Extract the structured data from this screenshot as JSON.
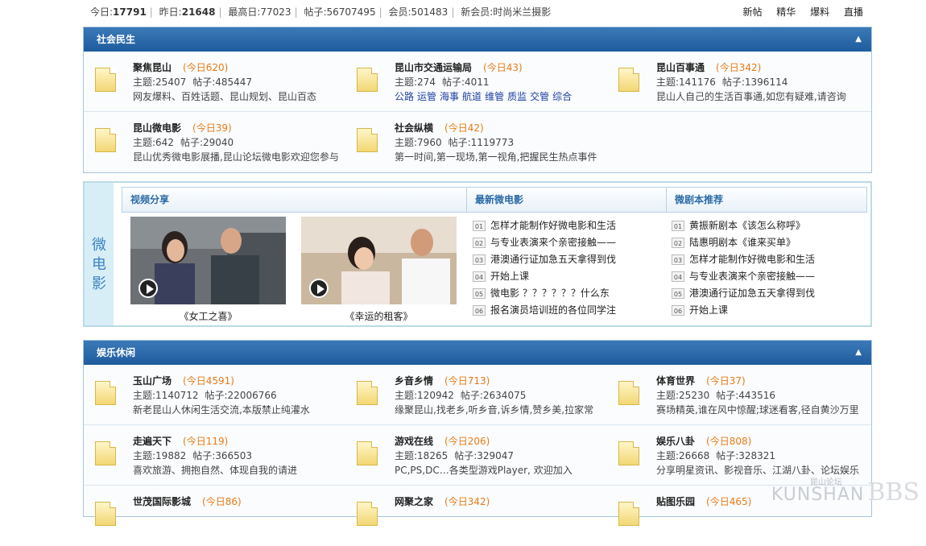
{
  "stats": {
    "today_label": "今日:",
    "today": "17791",
    "yesterday_label": "昨日:",
    "yesterday": "21648",
    "max_label": "最高日:",
    "max": "77023",
    "posts_label": "帖子:",
    "posts": "56707495",
    "members_label": "会员:",
    "members": "501483",
    "new_member_label": "新会员:",
    "new_member": "时尚米兰摄影"
  },
  "toplinks": [
    "新帖",
    "精华",
    "爆料",
    "直播"
  ],
  "section1": {
    "title": "社会民生",
    "forums": [
      {
        "name": "聚焦昆山",
        "today": "(今日620)",
        "topics": "主题:25407",
        "posts": "帖子:485447",
        "desc": "网友爆料、百姓话题、昆山规划、昆山百态"
      },
      {
        "name": "昆山市交通运输局",
        "today": "(今日43)",
        "topics": "主题:274",
        "posts": "帖子:4011",
        "links": [
          "公路",
          "运管",
          "海事",
          "航道",
          "维管",
          "质监",
          "交管",
          "综合"
        ]
      },
      {
        "name": "昆山百事通",
        "today": "(今日342)",
        "topics": "主题:141176",
        "posts": "帖子:1396114",
        "desc": "昆山人自己的生活百事通,如您有疑难,请咨询"
      },
      {
        "name": "昆山微电影",
        "today": "(今日39)",
        "topics": "主题:642",
        "posts": "帖子:29040",
        "desc": "昆山优秀微电影展播,昆山论坛微电影欢迎您参与"
      },
      {
        "name": "社会纵横",
        "today": "(今日42)",
        "topics": "主题:7960",
        "posts": "帖子:1119773",
        "desc": "第一时间,第一现场,第一视角,把握民生热点事件"
      }
    ]
  },
  "micro": {
    "side_label": [
      "微",
      "电",
      "影"
    ],
    "tabs": [
      "视频分享",
      "最新微电影",
      "微剧本推荐"
    ],
    "videos": [
      {
        "caption": "《女工之喜》"
      },
      {
        "caption": "《幸运的租客》"
      }
    ],
    "latest": [
      {
        "num": "01",
        "text": "怎样才能制作好微电影和生活"
      },
      {
        "num": "02",
        "text": "与专业表演来个亲密接触——"
      },
      {
        "num": "03",
        "text": "港澳通行证加急五天拿得到伐"
      },
      {
        "num": "04",
        "text": "开始上课"
      },
      {
        "num": "05",
        "text": "微电影 ？？？？？？什么东"
      },
      {
        "num": "06",
        "text": "报名演员培训班的各位同学注"
      }
    ],
    "scripts": [
      {
        "num": "01",
        "text": "黄振新剧本《该怎么称呼》"
      },
      {
        "num": "02",
        "text": "陆惠明剧本《谁来买单》"
      },
      {
        "num": "03",
        "text": "怎样才能制作好微电影和生活"
      },
      {
        "num": "04",
        "text": "与专业表演来个亲密接触——"
      },
      {
        "num": "05",
        "text": "港澳通行证加急五天拿得到伐"
      },
      {
        "num": "06",
        "text": "开始上课"
      }
    ]
  },
  "section2": {
    "title": "娱乐休闲",
    "forums": [
      {
        "name": "玉山广场",
        "today": "(今日4591)",
        "topics": "主题:1140712",
        "posts": "帖子:22006766",
        "desc": "新老昆山人休闲生活交流,本版禁止纯灌水"
      },
      {
        "name": "乡音乡情",
        "today": "(今日713)",
        "topics": "主题:120942",
        "posts": "帖子:2634075",
        "desc": "缘聚昆山,找老乡,听乡音,诉乡情,赞乡美,拉家常"
      },
      {
        "name": "体育世界",
        "today": "(今日37)",
        "topics": "主题:25230",
        "posts": "帖子:443516",
        "desc": "赛场精英,谁在风中惊醒;球迷看客,径自黄沙万里"
      },
      {
        "name": "走遍天下",
        "today": "(今日119)",
        "topics": "主题:19882",
        "posts": "帖子:366503",
        "desc": "喜欢旅游、拥抱自然、体现自我的请进"
      },
      {
        "name": "游戏在线",
        "today": "(今日206)",
        "topics": "主题:18265",
        "posts": "帖子:329047",
        "desc": "PC,PS,DC…各类型游戏Player, 欢迎加入"
      },
      {
        "name": "娱乐八卦",
        "today": "(今日808)",
        "topics": "主题:26668",
        "posts": "帖子:328321",
        "desc": "分享明星资讯、影视音乐、江湖八卦、论坛娱乐"
      },
      {
        "name": "世茂国际影城",
        "today": "(今日86)"
      },
      {
        "name": "网聚之家",
        "today": "(今日342)"
      },
      {
        "name": "贴图乐园",
        "today": "(今日465)"
      }
    ]
  },
  "logo": {
    "cn": "昆山论坛",
    "en": "KUNSHAN",
    "bbs": "BBS"
  }
}
